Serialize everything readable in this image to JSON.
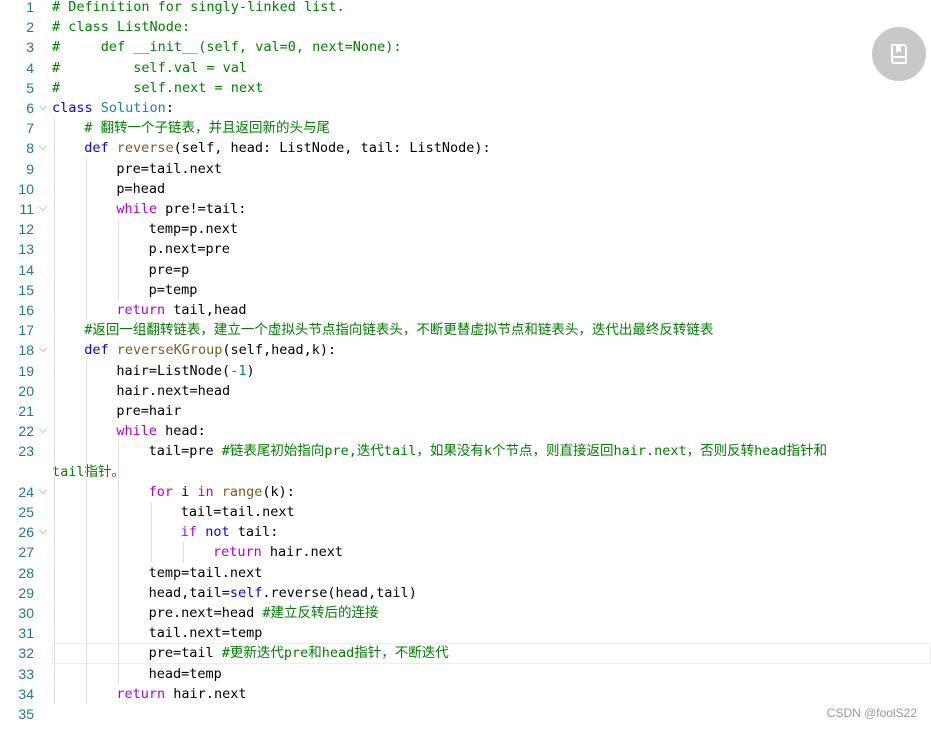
{
  "editor": {
    "lines": [
      {
        "no": "1",
        "indent": 0,
        "tokens": [
          {
            "t": "# Definition for singly-linked list.",
            "c": "cm"
          }
        ]
      },
      {
        "no": "2",
        "indent": 0,
        "tokens": [
          {
            "t": "# class ListNode:",
            "c": "cm"
          }
        ]
      },
      {
        "no": "3",
        "indent": 0,
        "tokens": [
          {
            "t": "#     def __init__(self, val=0, next=None):",
            "c": "cm"
          }
        ]
      },
      {
        "no": "4",
        "indent": 0,
        "tokens": [
          {
            "t": "#         self.val = val",
            "c": "cm"
          }
        ]
      },
      {
        "no": "5",
        "indent": 0,
        "tokens": [
          {
            "t": "#         self.next = next",
            "c": "cm"
          }
        ]
      },
      {
        "no": "6",
        "indent": 0,
        "fold": true,
        "tokens": [
          {
            "t": "class",
            "c": "kw"
          },
          {
            "t": " "
          },
          {
            "t": "Solution",
            "c": "cls"
          },
          {
            "t": ":"
          }
        ]
      },
      {
        "no": "7",
        "indent": 1,
        "tokens": [
          {
            "t": "# 翻转一个子链表，并且返回新的头与尾",
            "c": "cm"
          }
        ]
      },
      {
        "no": "8",
        "indent": 1,
        "fold": true,
        "tokens": [
          {
            "t": "def",
            "c": "kw"
          },
          {
            "t": " "
          },
          {
            "t": "reverse",
            "c": "fn"
          },
          {
            "t": "(self, head: ListNode, tail: ListNode):"
          }
        ]
      },
      {
        "no": "9",
        "indent": 2,
        "tokens": [
          {
            "t": "pre=tail.next"
          }
        ]
      },
      {
        "no": "10",
        "indent": 2,
        "tokens": [
          {
            "t": "p=head"
          }
        ]
      },
      {
        "no": "11",
        "indent": 2,
        "fold": true,
        "tokens": [
          {
            "t": "while",
            "c": "ctl"
          },
          {
            "t": " pre!=tail:"
          }
        ]
      },
      {
        "no": "12",
        "indent": 3,
        "tokens": [
          {
            "t": "temp=p.next"
          }
        ]
      },
      {
        "no": "13",
        "indent": 3,
        "tokens": [
          {
            "t": "p.next=pre"
          }
        ]
      },
      {
        "no": "14",
        "indent": 3,
        "tokens": [
          {
            "t": "pre=p"
          }
        ]
      },
      {
        "no": "15",
        "indent": 3,
        "tokens": [
          {
            "t": "p=temp"
          }
        ]
      },
      {
        "no": "16",
        "indent": 2,
        "tokens": [
          {
            "t": "return",
            "c": "ctl"
          },
          {
            "t": " tail,head"
          }
        ]
      },
      {
        "no": "17",
        "indent": 1,
        "tokens": [
          {
            "t": "#返回一组翻转链表，建立一个虚拟头节点指向链表头，不断更替虚拟节点和链表头，迭代出最终反转链表",
            "c": "cm"
          }
        ]
      },
      {
        "no": "18",
        "indent": 1,
        "fold": true,
        "tokens": [
          {
            "t": "def",
            "c": "kw"
          },
          {
            "t": " "
          },
          {
            "t": "reverseKGroup",
            "c": "fn"
          },
          {
            "t": "(self,head,k):"
          }
        ]
      },
      {
        "no": "19",
        "indent": 2,
        "tokens": [
          {
            "t": "hair=ListNode("
          },
          {
            "t": "-1",
            "c": "num"
          },
          {
            "t": ")"
          }
        ]
      },
      {
        "no": "20",
        "indent": 2,
        "tokens": [
          {
            "t": "hair.next=head"
          }
        ]
      },
      {
        "no": "21",
        "indent": 2,
        "tokens": [
          {
            "t": "pre=hair"
          }
        ]
      },
      {
        "no": "22",
        "indent": 2,
        "fold": true,
        "tokens": [
          {
            "t": "while",
            "c": "ctl"
          },
          {
            "t": " head:"
          }
        ]
      },
      {
        "no": "23",
        "indent": 3,
        "tokens": [
          {
            "t": "tail=pre "
          },
          {
            "t": "#链表尾初始指向pre,迭代tail，如果没有k个节点，则直接返回hair.next，否则反转head指针和",
            "c": "cm"
          }
        ],
        "wrap": [
          {
            "t": "tail指针。",
            "c": "cm"
          }
        ]
      },
      {
        "no": "24",
        "indent": 3,
        "fold": true,
        "tokens": [
          {
            "t": "for",
            "c": "ctl"
          },
          {
            "t": " i "
          },
          {
            "t": "in",
            "c": "ctl"
          },
          {
            "t": " "
          },
          {
            "t": "range",
            "c": "fn"
          },
          {
            "t": "(k):"
          }
        ]
      },
      {
        "no": "25",
        "indent": 4,
        "tokens": [
          {
            "t": "tail=tail.next"
          }
        ]
      },
      {
        "no": "26",
        "indent": 4,
        "fold": true,
        "tokens": [
          {
            "t": "if",
            "c": "ctl"
          },
          {
            "t": " "
          },
          {
            "t": "not",
            "c": "kw"
          },
          {
            "t": " tail:"
          }
        ]
      },
      {
        "no": "27",
        "indent": 5,
        "tokens": [
          {
            "t": "return",
            "c": "ctl"
          },
          {
            "t": " hair.next"
          }
        ]
      },
      {
        "no": "28",
        "indent": 3,
        "tokens": [
          {
            "t": "temp=tail.next"
          }
        ]
      },
      {
        "no": "29",
        "indent": 3,
        "tokens": [
          {
            "t": "head,tail="
          },
          {
            "t": "self",
            "c": "sf"
          },
          {
            "t": ".reverse(head,tail)"
          }
        ]
      },
      {
        "no": "30",
        "indent": 3,
        "tokens": [
          {
            "t": "pre.next=head "
          },
          {
            "t": "#建立反转后的连接",
            "c": "cm"
          }
        ]
      },
      {
        "no": "31",
        "indent": 3,
        "tokens": [
          {
            "t": "tail.next=temp"
          }
        ]
      },
      {
        "no": "32",
        "indent": 3,
        "current": true,
        "tokens": [
          {
            "t": "pre=tail "
          },
          {
            "t": "#更新迭代pre和head指针，不断迭代",
            "c": "cm"
          }
        ]
      },
      {
        "no": "33",
        "indent": 3,
        "tokens": [
          {
            "t": "head=temp"
          }
        ]
      },
      {
        "no": "34",
        "indent": 2,
        "tokens": [
          {
            "t": "return",
            "c": "ctl"
          },
          {
            "t": " hair.next"
          }
        ]
      },
      {
        "no": "35",
        "indent": 0,
        "tokens": []
      }
    ]
  },
  "watermark": "CSDN @foolS22",
  "read_button_icon": "book-icon",
  "colors": {
    "comment": "#008000",
    "keyword": "#0000ff",
    "control": "#af00db",
    "function": "#795e26",
    "class": "#267f99",
    "line_number": "#237893"
  }
}
